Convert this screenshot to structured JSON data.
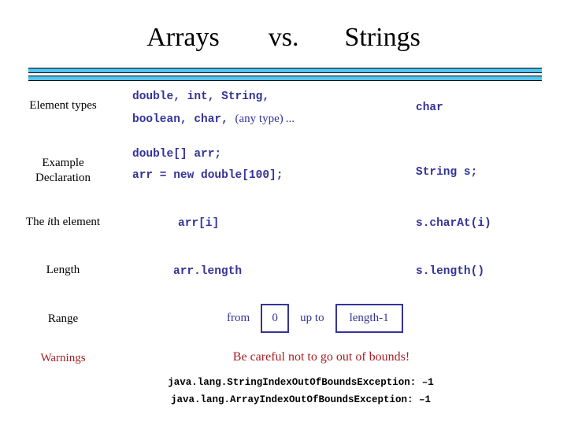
{
  "title": {
    "left": "Arrays",
    "middle": "vs.",
    "right": "Strings"
  },
  "colors": {
    "code_navy": "#333399",
    "warning_red": "#A51F24",
    "rule_blue": "#52C5F2",
    "text_black": "#000000"
  },
  "table": {
    "rows": [
      {
        "label": "Element types",
        "arrays_line1": "double, int, String,",
        "arrays_line2_code": "boolean, char, ",
        "arrays_line2_note": "(any type) ...",
        "strings": "char"
      },
      {
        "label_line1": "Example",
        "label_line2": "Declaration",
        "arrays_line1": "double[] arr;",
        "arrays_line2": "arr = new double[100];",
        "strings": "String s;"
      },
      {
        "label_prefix": "The ",
        "label_italic": "i",
        "label_suffix": "th element",
        "arrays": "arr[i]",
        "strings": "s.charAt(i)"
      },
      {
        "label": "Length",
        "arrays": "arr.length",
        "strings": "s.length()"
      }
    ],
    "range_row": {
      "label": "Range",
      "from_word": "from",
      "from_value": "0",
      "upto_word": "up to",
      "to_value": "length-1"
    },
    "warnings_row": {
      "label": "Warnings",
      "message": "Be careful not to go out of bounds!",
      "exceptions": [
        "java.lang.StringIndexOutOfBoundsException: –1",
        "java.lang.ArrayIndexOutOfBoundsException: –1"
      ]
    }
  }
}
